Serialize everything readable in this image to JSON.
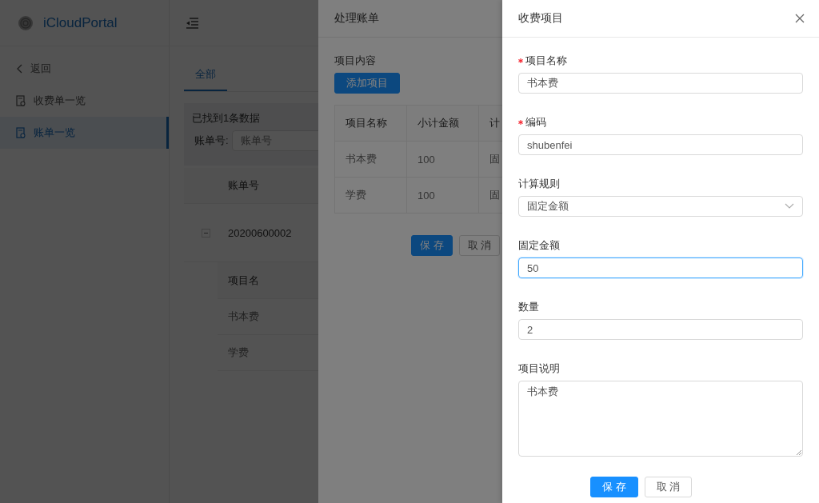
{
  "app": {
    "logo": "iCloudPortal",
    "sidebar": [
      {
        "label": "返回",
        "kind": "back",
        "selected": false
      },
      {
        "label": "收费单一览",
        "kind": "page",
        "selected": false
      },
      {
        "label": "账单一览",
        "kind": "page",
        "selected": true
      }
    ],
    "tabs": [
      {
        "label": "全部",
        "selected": true
      }
    ],
    "result_count": "已找到1条数据",
    "filter": {
      "label": "账单号:",
      "placeholder": "账单号"
    },
    "table": {
      "columns": [
        "账单号"
      ],
      "rows": [
        {
          "expanded": true,
          "cells": [
            "20200600002"
          ],
          "sub_table": {
            "columns": [
              "项目名"
            ],
            "rows": [
              [
                "书本费"
              ],
              [
                "学费"
              ]
            ]
          }
        }
      ]
    }
  },
  "bill_drawer": {
    "title": "处理账单",
    "section_label": "项目内容",
    "add_button": "添加项目",
    "table": {
      "columns": [
        "项目名称",
        "小计金额",
        "计"
      ],
      "rows": [
        [
          "书本费",
          "100",
          "固"
        ],
        [
          "学费",
          "100",
          "固"
        ]
      ]
    },
    "buttons": [
      {
        "label": "保 存",
        "kind": "primary"
      },
      {
        "label": "取 消",
        "kind": "default"
      }
    ]
  },
  "item_drawer": {
    "title": "收费项目",
    "fields": [
      {
        "label": "项目名称",
        "required": true,
        "kind": "input",
        "value": "书本费",
        "focused": false
      },
      {
        "label": "编码",
        "required": true,
        "kind": "input",
        "value": "shubenfei",
        "focused": false
      },
      {
        "label": "计算规则",
        "required": false,
        "kind": "select",
        "value": "固定金额",
        "focused": false
      },
      {
        "label": "固定金额",
        "required": false,
        "kind": "input",
        "value": "50",
        "focused": true
      },
      {
        "label": "数量",
        "required": false,
        "kind": "input",
        "value": "2",
        "focused": false
      },
      {
        "label": "项目说明",
        "required": false,
        "kind": "textarea",
        "value": "书本费",
        "focused": false
      }
    ],
    "buttons": [
      {
        "label": "保 存",
        "kind": "primary"
      },
      {
        "label": "取 消",
        "kind": "default"
      }
    ]
  }
}
